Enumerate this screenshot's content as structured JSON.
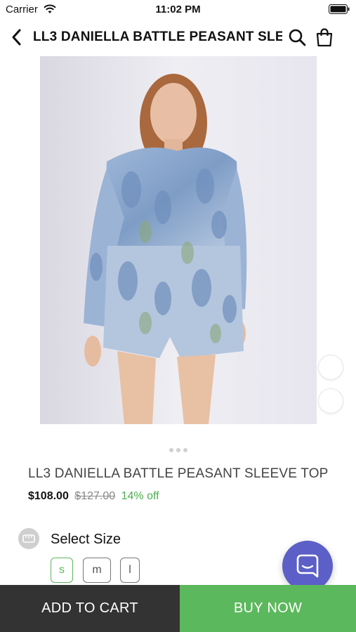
{
  "status_bar": {
    "carrier": "Carrier",
    "time": "11:02 PM"
  },
  "nav": {
    "title": "LL3 DANIELLA BATTLE PEASANT SLE..."
  },
  "product": {
    "title": "LL3 DANIELLA BATTLE PEASANT SLEEVE TOP",
    "price": "$108.00",
    "original_price": "$127.00",
    "discount": "14% off",
    "image_pages": 3,
    "current_image_page": 1
  },
  "size": {
    "label": "Select Size",
    "options": [
      "s",
      "m",
      "l"
    ],
    "selected": "s"
  },
  "actions": {
    "add_to_cart": "ADD TO CART",
    "buy_now": "BUY NOW"
  },
  "colors": {
    "accent_green": "#5cb85c",
    "dark_button": "#333333",
    "chat_fab": "#5b5fc7",
    "discount_text": "#4caf50"
  },
  "icons": {
    "back": "chevron-left-icon",
    "search": "search-icon",
    "cart": "shopping-bag-icon",
    "chat": "chat-bubble-icon",
    "size_guide": "size-guide-icon"
  }
}
